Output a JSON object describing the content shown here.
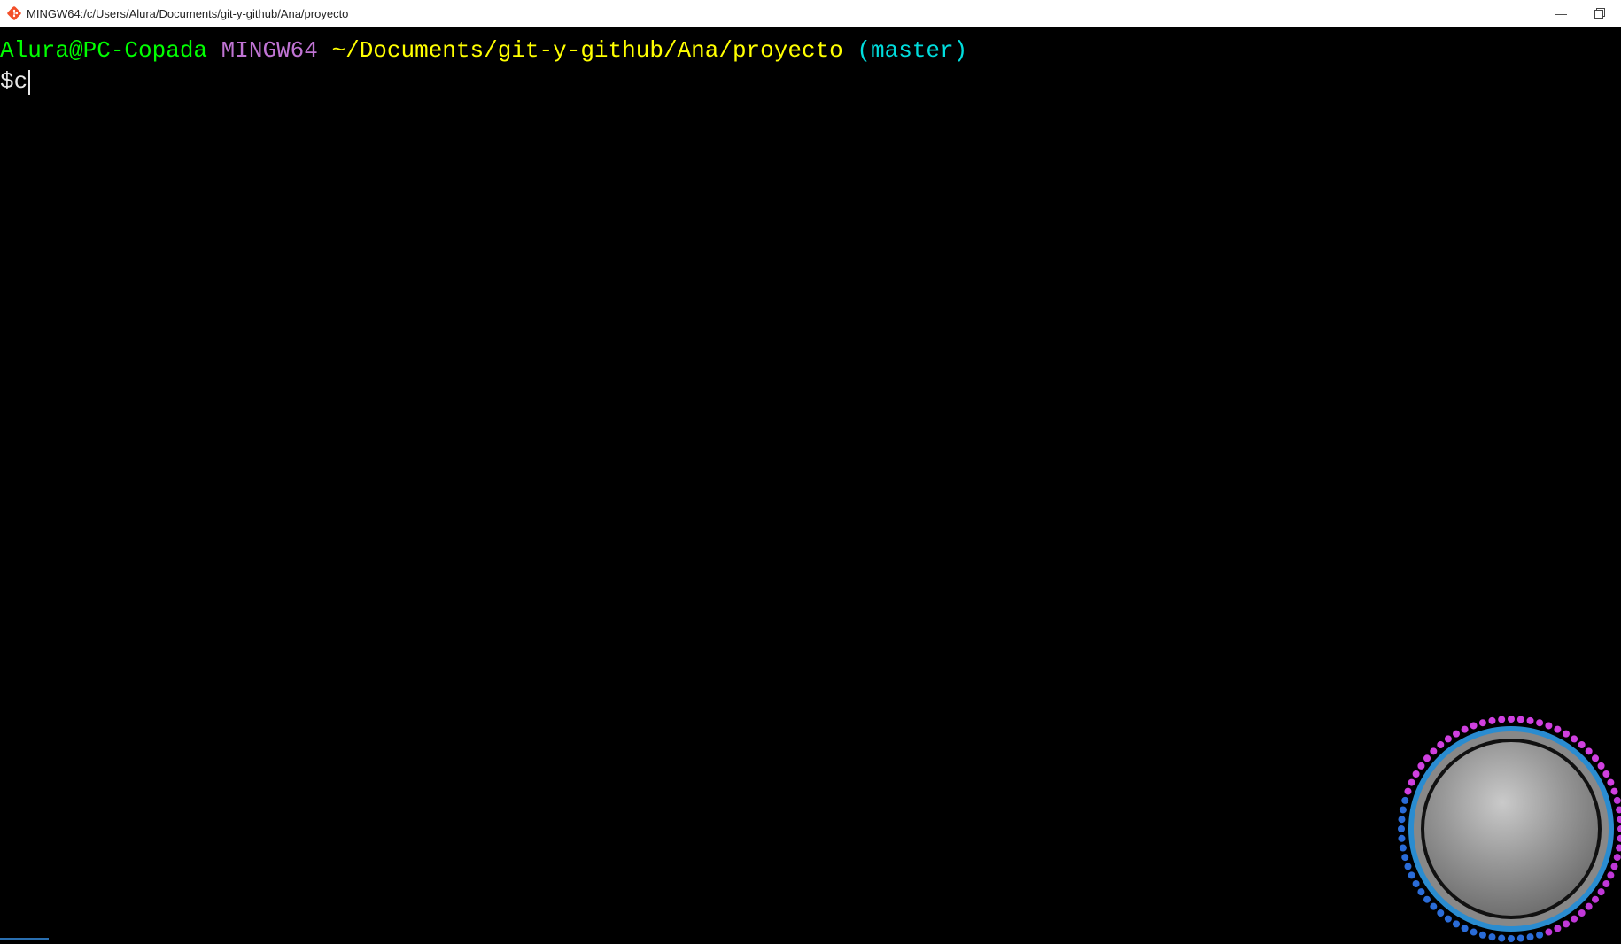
{
  "titlebar": {
    "title": "MINGW64:/c/Users/Alura/Documents/git-y-github/Ana/proyecto"
  },
  "terminal": {
    "prompt": {
      "user_host": "Alura@PC-Copada",
      "system": "MINGW64",
      "path": "~/Documents/git-y-github/Ana/proyecto",
      "branch": "(master)"
    },
    "input": {
      "symbol": "$",
      "typed": "c"
    }
  },
  "icons": {
    "minimize": "—",
    "maximize": "▢"
  }
}
